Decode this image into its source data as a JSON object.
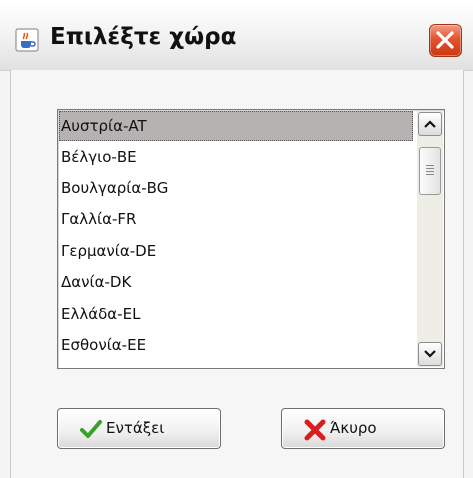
{
  "window": {
    "title": "Επιλέξτε χώρα",
    "app_icon": "java-cup-icon",
    "close_icon": "close-icon"
  },
  "country_list": {
    "selected_index": 0,
    "items": [
      "Αυστρία-AT",
      "Βέλγιο-BE",
      "Βουλγαρία-BG",
      "Γαλλία-FR",
      "Γερμανία-DE",
      "Δανία-DK",
      "Ελλάδα-EL",
      "Εσθονία-EE"
    ]
  },
  "scrollbar": {
    "up_icon": "chevron-up-icon",
    "down_icon": "chevron-down-icon"
  },
  "buttons": {
    "ok_label": "Εντάξει",
    "ok_icon": "checkmark-icon",
    "cancel_label": "Άκυρο",
    "cancel_icon": "red-x-icon"
  },
  "colors": {
    "selection_background": "#b6b2b2",
    "ok_icon_color": "#3aa02c",
    "cancel_icon_color": "#d81e1e",
    "close_button_color": "#d94b25"
  }
}
